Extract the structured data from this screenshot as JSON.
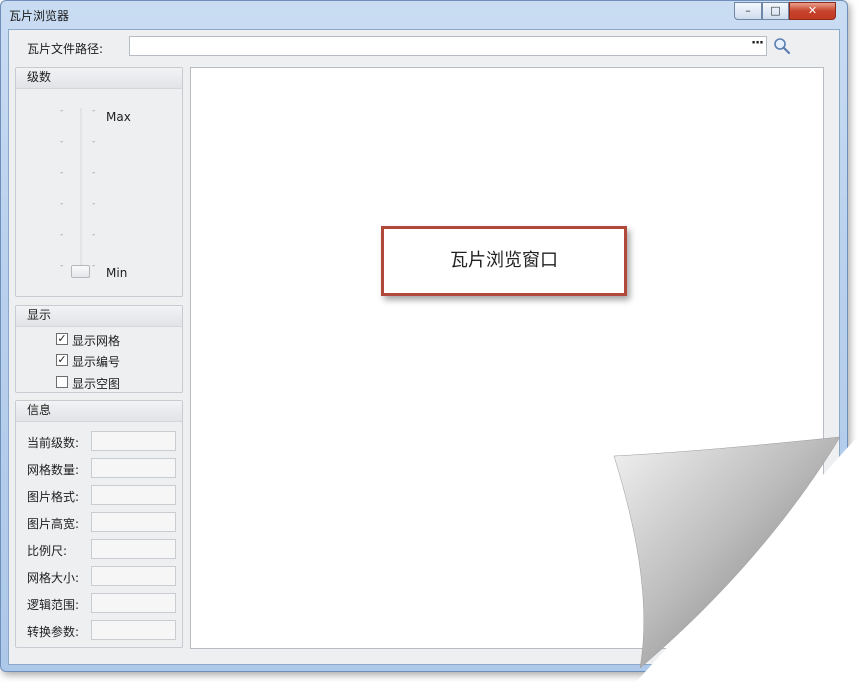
{
  "window": {
    "title": "瓦片浏览器",
    "controls": {
      "minimize": "–",
      "maximize": "□",
      "close": "✕"
    }
  },
  "path": {
    "label": "瓦片文件路径:",
    "value": "",
    "browse_label": "···",
    "search_icon": "magnifier-icon"
  },
  "level": {
    "header": "级数",
    "max_label": "Max",
    "min_label": "Min",
    "tick_mark": "-"
  },
  "display": {
    "header": "显示",
    "options": [
      {
        "label": "显示网格",
        "checked": true
      },
      {
        "label": "显示编号",
        "checked": true
      },
      {
        "label": "显示空图",
        "checked": false
      }
    ]
  },
  "info": {
    "header": "信息",
    "fields": [
      {
        "label": "当前级数:",
        "value": ""
      },
      {
        "label": "网格数量:",
        "value": ""
      },
      {
        "label": "图片格式:",
        "value": ""
      },
      {
        "label": "图片高宽:",
        "value": ""
      },
      {
        "label": "比例尺:",
        "value": ""
      },
      {
        "label": "网格大小:",
        "value": ""
      },
      {
        "label": "逻辑范围:",
        "value": ""
      },
      {
        "label": "转换参数:",
        "value": ""
      }
    ]
  },
  "viewer": {
    "callout_text": "瓦片浏览窗口"
  },
  "colors": {
    "callout_border": "#b2483b",
    "window_frame": "#b9d1ee",
    "close_button": "#c7432b"
  }
}
